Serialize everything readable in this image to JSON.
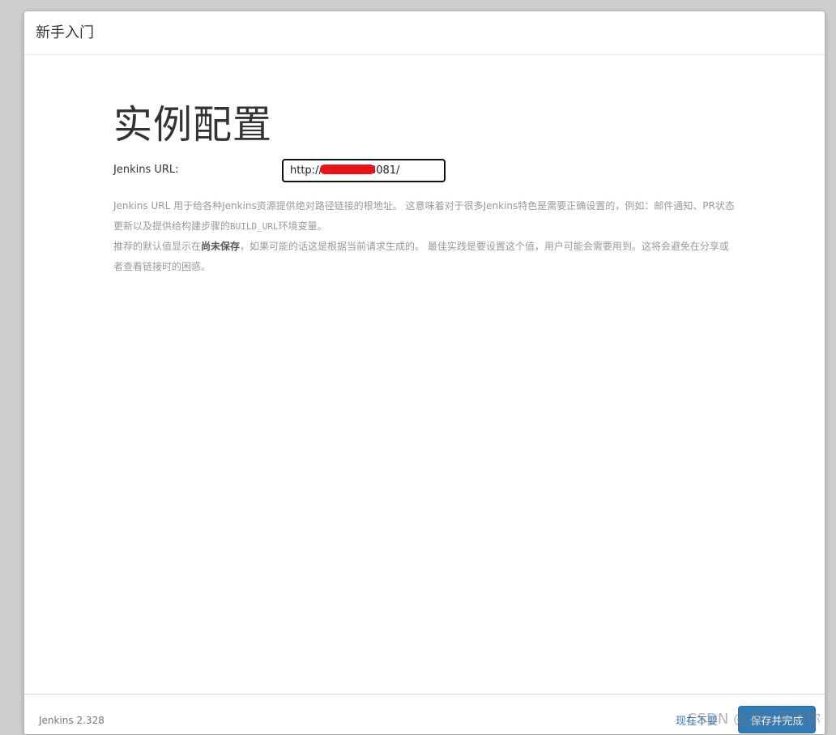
{
  "dialog": {
    "title": "新手入门"
  },
  "main": {
    "heading": "实例配置",
    "url_label": "Jenkins URL:",
    "url_value": "http://           5:8081/",
    "help": {
      "line1_part1": "Jenkins URL 用于给各种Jenkins资源提供绝对路径链接的根地址。 这意味着对于很多Jenkins特色是需要正确设置的，例如：邮件通知、PR状态更新以及提供给构建步骤的",
      "line1_code": "BUILD_URL",
      "line1_part2": "环境变量。",
      "line2_part1": "推荐的默认值显示在",
      "line2_bold": "尚未保存",
      "line2_part2": "，如果可能的话这是根据当前请求生成的。 最佳实践是要设置这个值，用户可能会需要用到。这将会避免在分享或者查看链接时的困惑。"
    }
  },
  "footer": {
    "version": "Jenkins 2.328",
    "skip_label": "现在不要",
    "save_label": "保存并完成"
  },
  "watermark": "CSDN @我认不到你",
  "colors": {
    "primary": "#337ab7",
    "redaction": "#e8141c"
  }
}
